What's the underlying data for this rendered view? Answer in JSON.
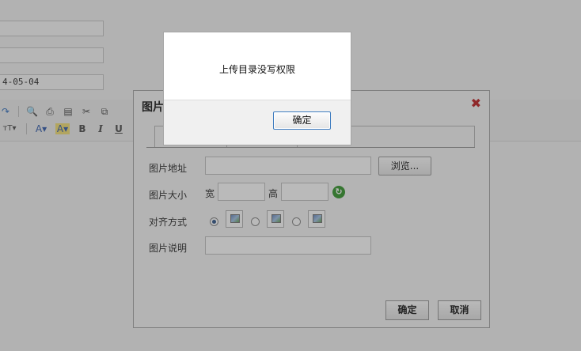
{
  "background": {
    "date_field_value": "4-05-04",
    "toolbar_icons_row1": [
      "redo-icon",
      "preview-icon",
      "print-icon",
      "template-icon",
      "cut-icon",
      "copy-icon"
    ],
    "toolbar_icons_row2": [
      "font-size-icon",
      "font-color-icon",
      "highlight-icon",
      "bold-icon",
      "italic-icon",
      "underline-icon"
    ],
    "toolbar_labels_row2": {
      "font_size": "ᴛT▾",
      "font_color": "A▾",
      "highlight": "A▾",
      "bold": "B",
      "italic": "I",
      "underline": "U"
    }
  },
  "image_dialog": {
    "title": "图片",
    "close_glyph": "✖",
    "labels": {
      "url": "图片地址",
      "size": "图片大小",
      "align": "对齐方式",
      "desc": "图片说明"
    },
    "browse_button": "浏览...",
    "width_label": "宽",
    "height_label": "高",
    "refresh_glyph": "↻",
    "align_selected_index": 0,
    "ok_button": "确定",
    "cancel_button": "取消"
  },
  "alert": {
    "message": "上传目录没写权限",
    "ok_button": "确定",
    "accent_color": "#3d7bbf"
  }
}
